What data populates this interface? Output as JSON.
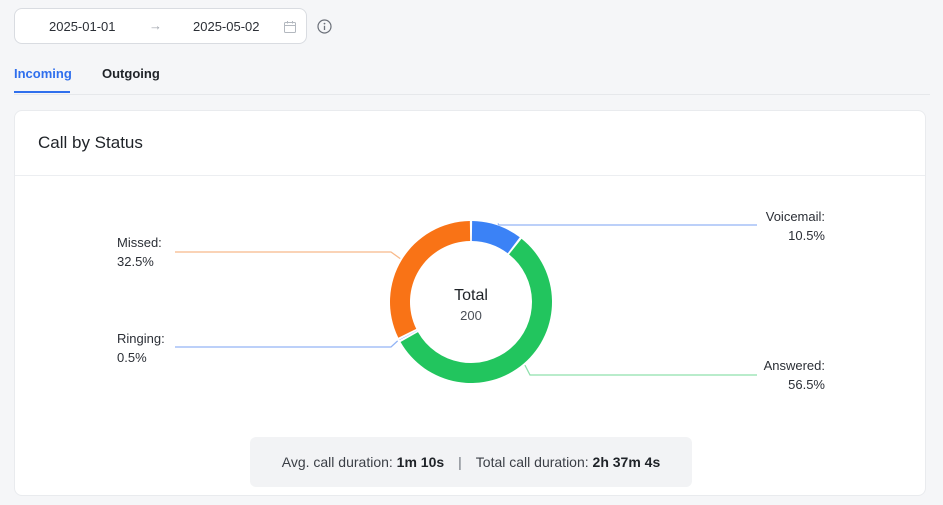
{
  "date_range": {
    "start": "2025-01-01",
    "arrow": "→",
    "end": "2025-05-02"
  },
  "tabs": [
    {
      "label": "Incoming",
      "active": true
    },
    {
      "label": "Outgoing",
      "active": false
    }
  ],
  "card": {
    "title": "Call by Status"
  },
  "colors": {
    "accent": "#2f6fed",
    "voicemail": "#3b82f6",
    "answered": "#22c55e",
    "missed": "#f97316",
    "ringing": "#93b4f5"
  },
  "chart_data": {
    "type": "pie",
    "center_label": "Total",
    "total": "200",
    "slices": [
      {
        "name": "Voicemail:",
        "value": 10.5,
        "label": "10.5%",
        "color": "#3b82f6"
      },
      {
        "name": "Answered:",
        "value": 56.5,
        "label": "56.5%",
        "color": "#22c55e"
      },
      {
        "name": "Ringing:",
        "value": 0.5,
        "label": "0.5%",
        "color": "#3b82f6"
      },
      {
        "name": "Missed:",
        "value": 32.5,
        "label": "32.5%",
        "color": "#f97316"
      }
    ]
  },
  "summary": {
    "avg_label": "Avg. call duration:",
    "avg_value": "1m 10s",
    "separator": "|",
    "total_label": "Total call duration:",
    "total_value": "2h 37m 4s"
  }
}
